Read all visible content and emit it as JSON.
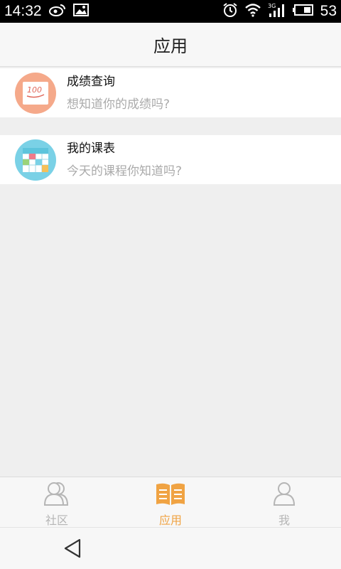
{
  "status_bar": {
    "time": "14:32",
    "battery_level": "53",
    "left_icons": [
      "weibo-icon",
      "image-icon"
    ],
    "right_icons": [
      "alarm-icon",
      "wifi-icon",
      "3g-signal-icon",
      "battery-icon"
    ]
  },
  "header": {
    "title": "应用"
  },
  "apps": [
    {
      "title": "成绩查询",
      "subtitle": "想知道你的成绩吗?",
      "icon": "grade-report-icon",
      "icon_text": "100",
      "icon_color": "#f5a98a"
    },
    {
      "title": "我的课表",
      "subtitle": "今天的课程你知道吗?",
      "icon": "timetable-icon",
      "icon_color": "#7ad1e6"
    }
  ],
  "tabs": [
    {
      "label": "社区",
      "icon": "community-icon",
      "active": false
    },
    {
      "label": "应用",
      "icon": "book-icon",
      "active": true
    },
    {
      "label": "我",
      "icon": "person-icon",
      "active": false
    }
  ],
  "nav": {
    "back_icon": "back-triangle-icon"
  },
  "colors": {
    "accent": "#f0a343",
    "inactive": "#b5b5b5",
    "background": "#efefef"
  }
}
